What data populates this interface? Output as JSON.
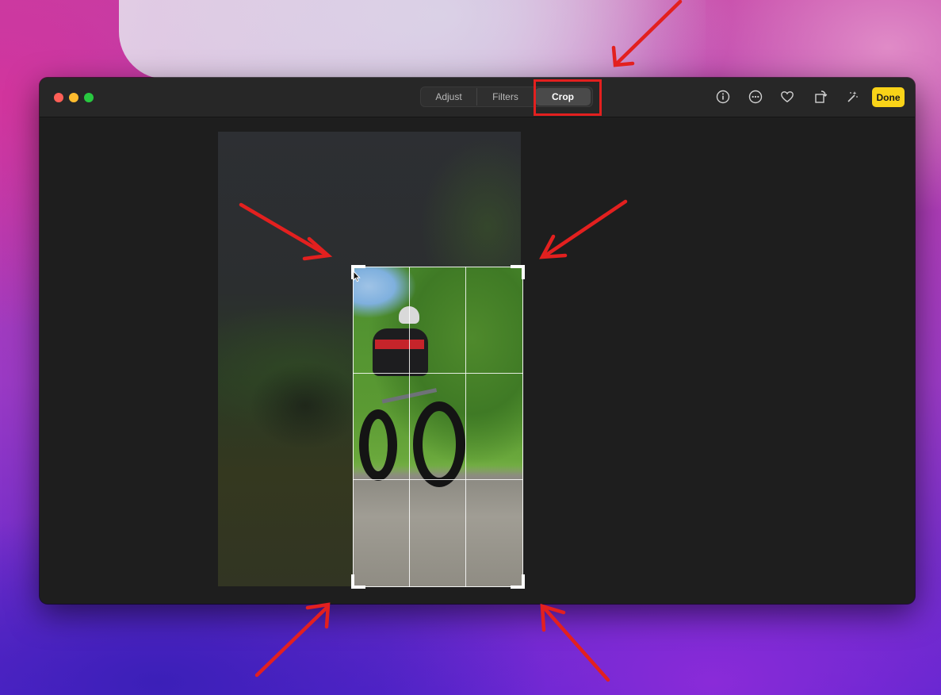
{
  "toolbar": {
    "tabs": [
      {
        "label": "Adjust",
        "selected": false
      },
      {
        "label": "Filters",
        "selected": false
      },
      {
        "label": "Crop",
        "selected": true
      }
    ],
    "done_label": "Done",
    "icons": [
      "info-icon",
      "more-icon",
      "heart-icon",
      "rotate-icon",
      "auto-enhance-icon"
    ]
  },
  "colors": {
    "done_button": "#f9d318",
    "annotation_red": "#e3201f",
    "window_bg": "#1e1e1e"
  },
  "crop": {
    "grid": "3x3",
    "photo_subject": "cyclist-on-fat-bike"
  }
}
